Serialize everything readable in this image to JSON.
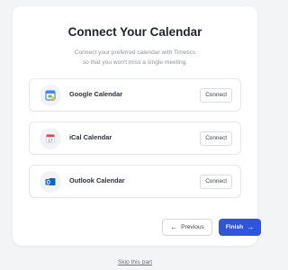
{
  "header": {
    "title": "Connect Your Calendar",
    "subtitle_line1": "Connect your preferred calendar with Timetics",
    "subtitle_line2": "so that you won't miss a single meeting."
  },
  "calendars": [
    {
      "name": "Google Calendar",
      "icon": "google-calendar-icon",
      "action": "Connect"
    },
    {
      "name": "iCal Calendar",
      "icon": "ical-calendar-icon",
      "action": "Connect"
    },
    {
      "name": "Outlook Calendar",
      "icon": "outlook-calendar-icon",
      "action": "Connect"
    }
  ],
  "footer": {
    "previous_label": "Previous",
    "finish_label": "Finish",
    "skip_label": "Skip this part"
  },
  "colors": {
    "primary": "#2f56d8",
    "background": "#f3f4f6",
    "card": "#ffffff"
  }
}
